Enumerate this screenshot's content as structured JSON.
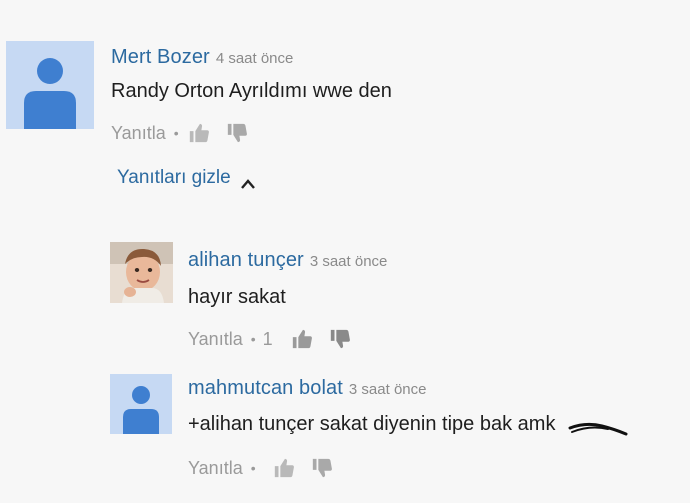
{
  "comments": [
    {
      "author": "Mert Bozer",
      "timestamp": "4 saat önce",
      "text": "Randy Orton Ayrıldımı wwe den",
      "reply_label": "Yanıtla",
      "separator": "•",
      "likes": ""
    },
    {
      "author": "alihan tunçer",
      "timestamp": "3 saat önce",
      "text": "hayır sakat",
      "reply_label": "Yanıtla",
      "separator": "•",
      "likes": "1"
    },
    {
      "author": "mahmutcan bolat",
      "timestamp": "3 saat önce",
      "text": "+alihan tunçer sakat diyenin tipe bak amk",
      "reply_label": "Yanıtla",
      "separator": "•",
      "likes": ""
    }
  ],
  "toggle": {
    "label": "Yanıtları gizle",
    "icon": "chevron-up-icon"
  },
  "icons": {
    "avatar": "default-avatar-icon",
    "like": "thumbs-up-icon",
    "dislike": "thumbs-down-icon"
  },
  "colors": {
    "author_link": "#2c6aa0",
    "avatar_bg": "#c6d9f3",
    "avatar_fg": "#3f7fd0",
    "muted": "#9a9a9a"
  }
}
